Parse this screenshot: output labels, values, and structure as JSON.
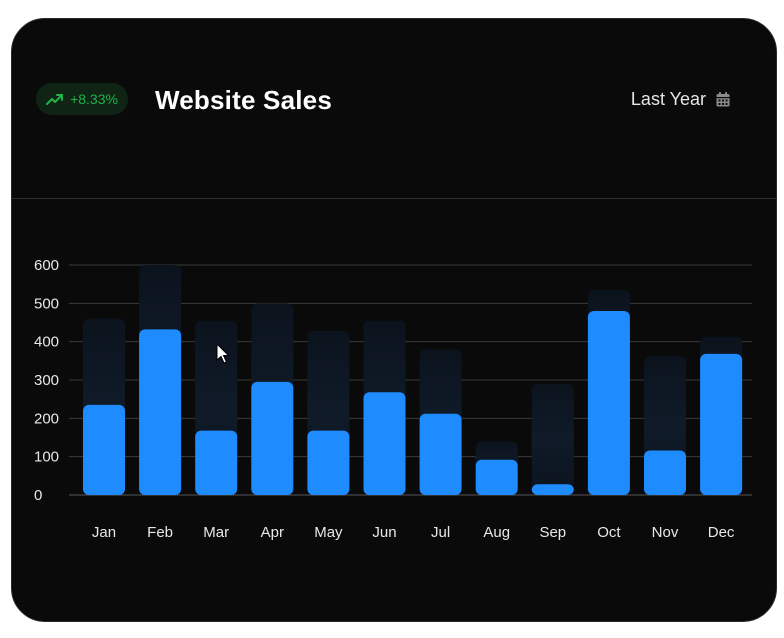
{
  "header": {
    "badge_text": "+8.33%",
    "badge_icon": "trending-up-icon",
    "title": "Website Sales",
    "period_label": "Last Year",
    "period_icon": "calendar-icon"
  },
  "colors": {
    "bar": "#1e8cff",
    "bar_background": "#101b29",
    "badge_text": "#22b24a",
    "badge_background": "#0f2414",
    "grid": "#3a3a3a",
    "card_background": "#0a0a0a"
  },
  "chart_data": {
    "type": "bar",
    "categories": [
      "Jan",
      "Feb",
      "Mar",
      "Apr",
      "May",
      "Jun",
      "Jul",
      "Aug",
      "Sep",
      "Oct",
      "Nov",
      "Dec"
    ],
    "series": [
      {
        "values": [
          235,
          432,
          168,
          295,
          168,
          268,
          212,
          92,
          28,
          480,
          116,
          368
        ]
      },
      {
        "values": [
          460,
          600,
          455,
          500,
          428,
          455,
          380,
          140,
          290,
          535,
          362,
          413
        ]
      }
    ],
    "yticks": [
      0,
      100,
      200,
      300,
      400,
      500,
      600
    ],
    "ylim": [
      0,
      600
    ],
    "grid": true,
    "title": "Website Sales"
  }
}
